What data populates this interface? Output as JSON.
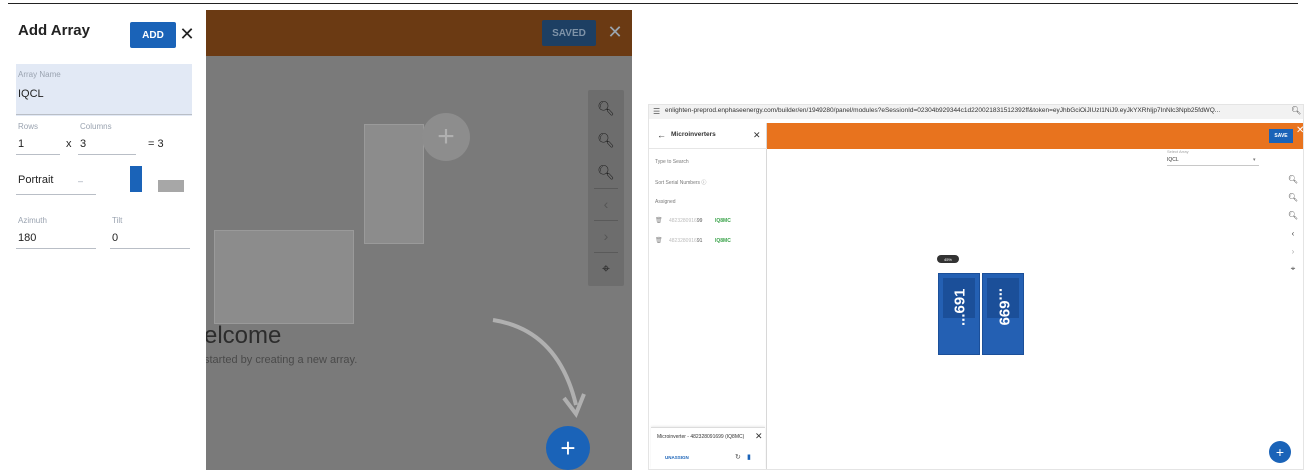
{
  "left": {
    "toolbar": {
      "saved_label": "SAVED",
      "close_glyph": "✕"
    },
    "zoom_controls": [
      "zoom-in-icon",
      "zoom-out-icon",
      "zoom-fit-icon",
      "chevron-left-icon",
      "chevron-right-icon",
      "center-focus-icon"
    ],
    "canvas": {
      "welcome_title": "Welcome",
      "welcome_subtitle": "started by creating a new array.",
      "welcome_title_visible": "elcome",
      "welcome_subtitle_visible": "started by creating a new array."
    },
    "add_array_form": {
      "title": "Add Array",
      "add_label": "ADD",
      "close_glyph": "✕",
      "array_name": {
        "label": "Array Name",
        "value": "IQCL"
      },
      "rows": {
        "label": "Rows",
        "value": "1"
      },
      "times_glyph": "x",
      "columns": {
        "label": "Columns",
        "value": "3"
      },
      "equals_total": "= 3",
      "orientation": {
        "value": "Portrait"
      },
      "azimuth": {
        "label": "Azimuth",
        "value": "180"
      },
      "tilt": {
        "label": "Tilt",
        "value": "0"
      }
    },
    "colors": {
      "topbar": "#6b3a13",
      "accent": "#1a63b8",
      "overlay": "#7a7a7a"
    }
  },
  "right": {
    "address_bar": {
      "url": "enlighten-preprod.enphaseenergy.com/builder/en/1949280/panel/modules?eSessionId=02304b929344c1d220021831512392ff&token=eyJhbGciOiJIUzI1NiJ9.eyJkYXRhIjp7InNlc3Npb25fdWQ..."
    },
    "toolbar": {
      "save_label": "SAVE",
      "close_glyph": "✕"
    },
    "microinverters_panel": {
      "title": "Microinverters",
      "search_placeholder": "Type to Search",
      "sort_label": "Sort Serial Numbers ⓘ",
      "assigned_label": "Assigned",
      "items": [
        {
          "serial_prefix": "4823280916",
          "serial_suffix": "99",
          "model": "IQ8MC"
        },
        {
          "serial_prefix": "4823280916",
          "serial_suffix": "91",
          "model": "IQ8MC"
        }
      ]
    },
    "select_array": {
      "label": "Select Array",
      "value": "IQCL"
    },
    "array_badge": "45%",
    "modules": [
      {
        "label": "...691"
      },
      {
        "label": "...699"
      }
    ],
    "detail_card": {
      "title": "Microinverter - 482328091699 (IQ8MC)",
      "unassign_label": "UNASSIGN"
    },
    "colors": {
      "topbar": "#e8731e",
      "accent": "#1a63b8",
      "module": "#2460b3",
      "model_text": "#3aa34a"
    }
  }
}
